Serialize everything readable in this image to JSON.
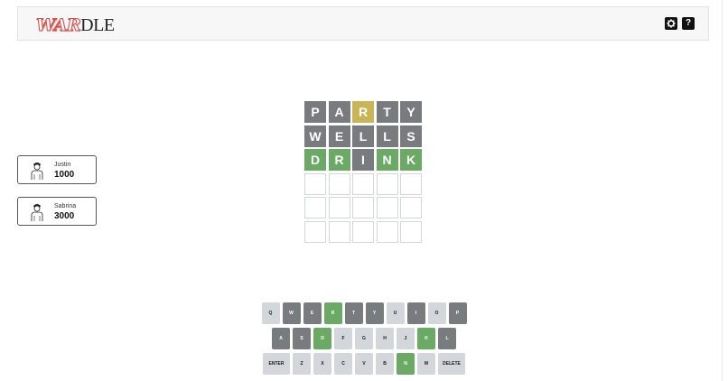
{
  "header": {
    "logo_war": "WAR",
    "logo_dle": "DLE",
    "settings_icon": "gear-icon",
    "help_icon": "question-icon",
    "help_glyph": "?"
  },
  "players": [
    {
      "name": "Justin",
      "score": "1000",
      "avatar_icon": "person-avatar-icon"
    },
    {
      "name": "Sabrina",
      "score": "3000",
      "avatar_icon": "person-avatar-icon"
    }
  ],
  "board": {
    "rows": [
      [
        {
          "letter": "P",
          "state": "absent"
        },
        {
          "letter": "A",
          "state": "absent"
        },
        {
          "letter": "R",
          "state": "present"
        },
        {
          "letter": "T",
          "state": "absent"
        },
        {
          "letter": "Y",
          "state": "absent"
        }
      ],
      [
        {
          "letter": "W",
          "state": "absent"
        },
        {
          "letter": "E",
          "state": "absent"
        },
        {
          "letter": "L",
          "state": "absent"
        },
        {
          "letter": "L",
          "state": "absent"
        },
        {
          "letter": "S",
          "state": "absent"
        }
      ],
      [
        {
          "letter": "D",
          "state": "correct"
        },
        {
          "letter": "R",
          "state": "correct"
        },
        {
          "letter": "I",
          "state": "absent"
        },
        {
          "letter": "N",
          "state": "correct"
        },
        {
          "letter": "K",
          "state": "correct"
        }
      ],
      [
        {
          "letter": "",
          "state": "empty"
        },
        {
          "letter": "",
          "state": "empty"
        },
        {
          "letter": "",
          "state": "empty"
        },
        {
          "letter": "",
          "state": "empty"
        },
        {
          "letter": "",
          "state": "empty"
        }
      ],
      [
        {
          "letter": "",
          "state": "empty"
        },
        {
          "letter": "",
          "state": "empty"
        },
        {
          "letter": "",
          "state": "empty"
        },
        {
          "letter": "",
          "state": "empty"
        },
        {
          "letter": "",
          "state": "empty"
        }
      ],
      [
        {
          "letter": "",
          "state": "empty"
        },
        {
          "letter": "",
          "state": "empty"
        },
        {
          "letter": "",
          "state": "empty"
        },
        {
          "letter": "",
          "state": "empty"
        },
        {
          "letter": "",
          "state": "empty"
        }
      ]
    ]
  },
  "keyboard": {
    "rows": [
      [
        {
          "label": "Q",
          "state": "unused"
        },
        {
          "label": "W",
          "state": "absent"
        },
        {
          "label": "E",
          "state": "absent"
        },
        {
          "label": "R",
          "state": "correct"
        },
        {
          "label": "T",
          "state": "absent"
        },
        {
          "label": "Y",
          "state": "absent"
        },
        {
          "label": "U",
          "state": "unused"
        },
        {
          "label": "I",
          "state": "absent"
        },
        {
          "label": "O",
          "state": "unused"
        },
        {
          "label": "P",
          "state": "absent"
        }
      ],
      [
        {
          "label": "A",
          "state": "absent"
        },
        {
          "label": "S",
          "state": "absent"
        },
        {
          "label": "D",
          "state": "correct"
        },
        {
          "label": "F",
          "state": "unused"
        },
        {
          "label": "G",
          "state": "unused"
        },
        {
          "label": "H",
          "state": "unused"
        },
        {
          "label": "J",
          "state": "unused"
        },
        {
          "label": "K",
          "state": "correct"
        },
        {
          "label": "L",
          "state": "absent"
        }
      ],
      [
        {
          "label": "ENTER",
          "state": "unused",
          "wide": true
        },
        {
          "label": "Z",
          "state": "unused"
        },
        {
          "label": "X",
          "state": "unused"
        },
        {
          "label": "C",
          "state": "unused"
        },
        {
          "label": "V",
          "state": "unused"
        },
        {
          "label": "B",
          "state": "unused"
        },
        {
          "label": "N",
          "state": "correct"
        },
        {
          "label": "M",
          "state": "unused"
        },
        {
          "label": "DELETE",
          "state": "unused",
          "wide": true
        }
      ]
    ]
  },
  "colors": {
    "absent": "#787c7e",
    "present": "#c9b458",
    "correct": "#6aaa64",
    "key_unused": "#d3d6da",
    "logo_red": "#d9534f"
  }
}
